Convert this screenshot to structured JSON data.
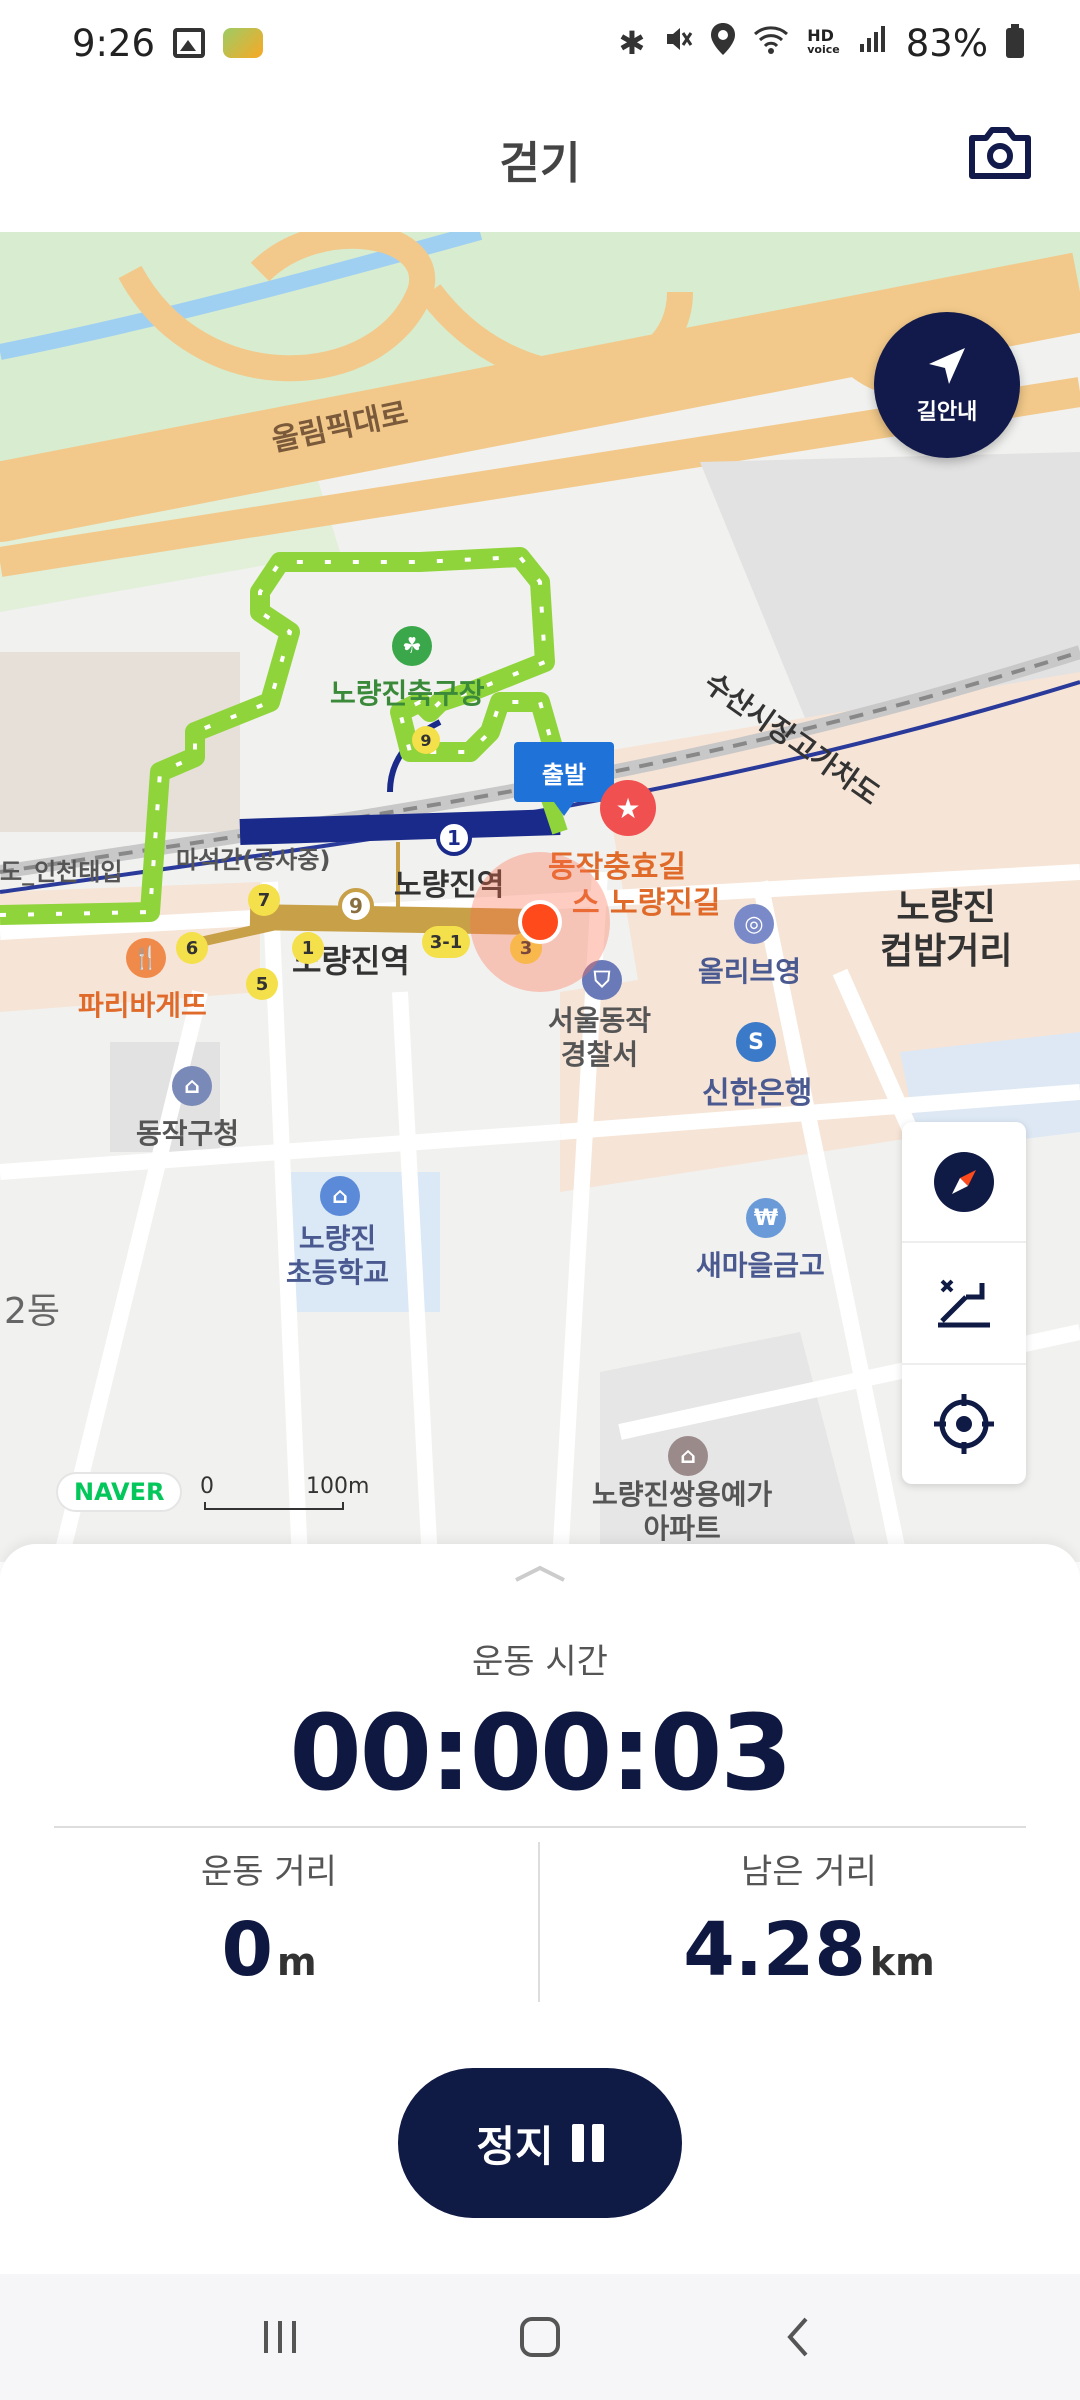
{
  "status_bar": {
    "time": "9:26",
    "battery": "83%",
    "hd_label": "HD",
    "voice_label": "voice",
    "icons": [
      "gallery-icon",
      "app-badge-icon",
      "bluetooth-icon",
      "mute-icon",
      "location-icon",
      "wifi-icon",
      "signal-icon",
      "battery-icon"
    ]
  },
  "header": {
    "title": "걷기",
    "camera_icon": "camera-icon"
  },
  "map": {
    "navi_button_label": "길안내",
    "start_flag": "출발",
    "labels": {
      "olympic_road": "올림픽대로",
      "fish_market_overpass": "수산시장고가차도",
      "noryangjin_parking": "노량진축구장",
      "subway_station_1": "노량진역",
      "subway_station_2": "노량진역",
      "hyo_road": "동작충효길",
      "bus_road": "스 노량진길",
      "incheon_airport": "도_인천태입",
      "masukgan": "마석간(공사중)",
      "paris_baguette": "파리바게뜨",
      "olive_young": "올리브영",
      "cupbap_street": "노량진\n컵밥거리",
      "police_station": "서울동작\n경찰서",
      "shinhan_bank": "신한은행",
      "dongjak_office": "동작구청",
      "elementary_school": "노량진\n초등학교",
      "saemaul_bank": "새마을금고",
      "dong2": "2동",
      "apartment": "노량진쌍용예가\n아파트"
    },
    "exit_numbers": [
      "1",
      "9",
      "7",
      "9",
      "6",
      "5",
      "1",
      "3-1",
      "3"
    ],
    "naver_logo": "NAVER",
    "scale_zero": "0",
    "scale_max": "100m",
    "tools": [
      "compass-icon",
      "elevation-icon",
      "locate-icon"
    ]
  },
  "stats": {
    "time_label": "운동 시간",
    "time_value": "00:00:03",
    "distance_label": "운동 거리",
    "distance_value": "0",
    "distance_unit": "m",
    "remaining_label": "남은 거리",
    "remaining_value": "4.28",
    "remaining_unit": "km"
  },
  "controls": {
    "stop_label": "정지"
  },
  "colors": {
    "navy": "#0f1840",
    "route_green": "#8fd43a",
    "location_orange": "#ff4a1c",
    "subway_blue": "#1a2a8a",
    "subway_gold": "#c8a048"
  }
}
